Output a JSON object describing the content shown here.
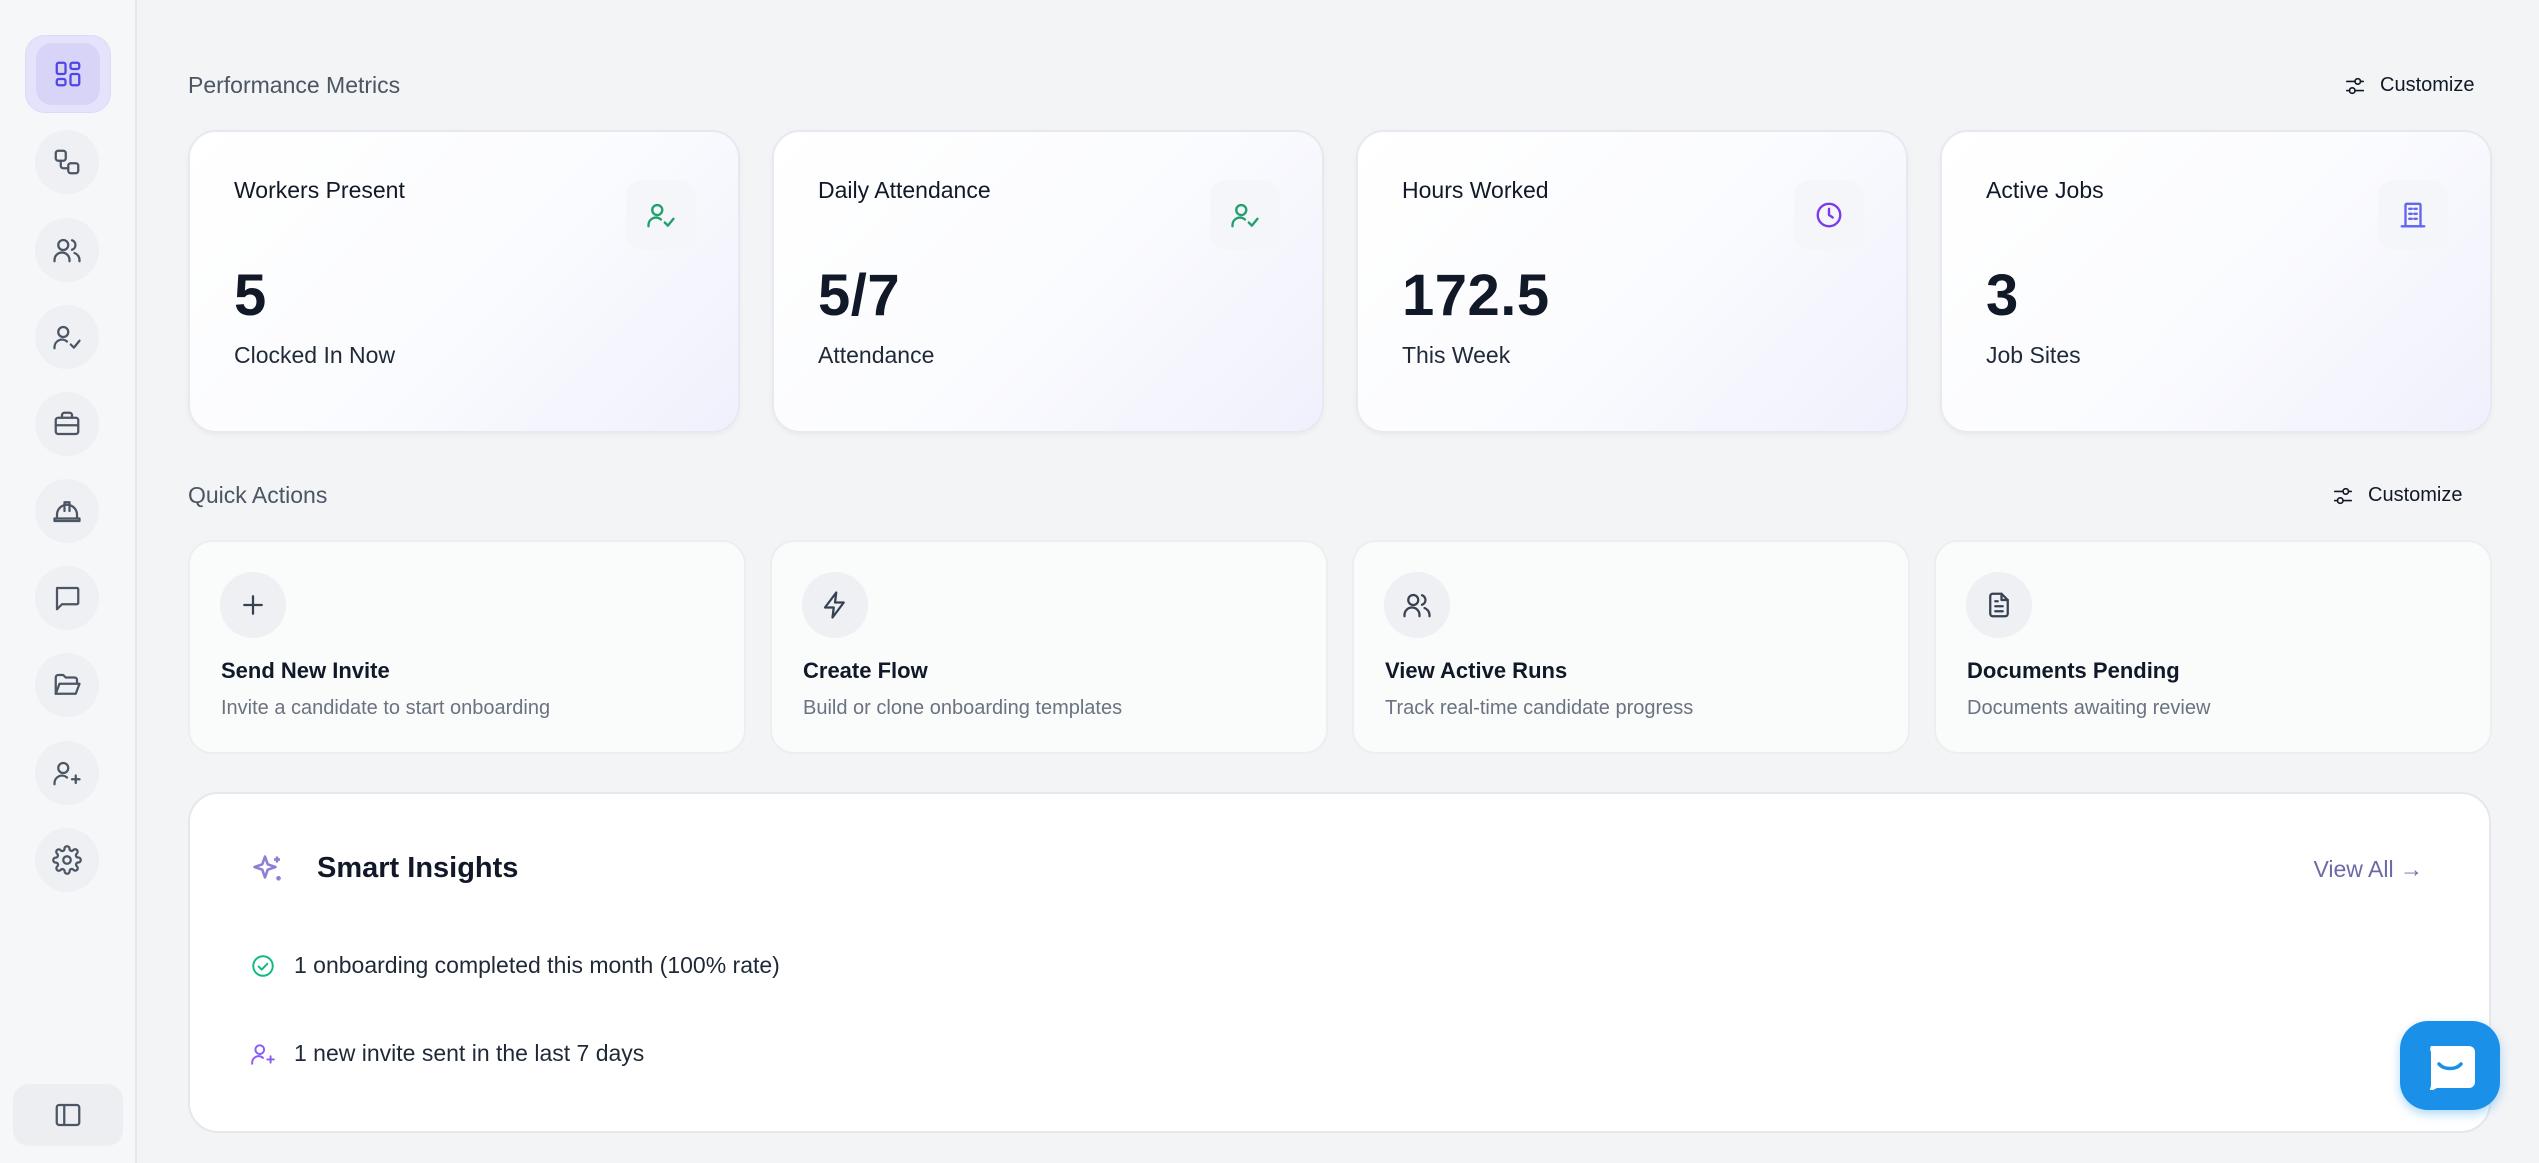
{
  "sidebar": {
    "items": [
      {
        "name": "dashboard",
        "icon": "dashboard-grid-icon"
      },
      {
        "name": "workflows",
        "icon": "workflow-icon"
      },
      {
        "name": "users",
        "icon": "users-icon"
      },
      {
        "name": "attendance",
        "icon": "user-check-icon"
      },
      {
        "name": "jobs",
        "icon": "briefcase-icon"
      },
      {
        "name": "safety",
        "icon": "hard-hat-icon"
      },
      {
        "name": "messages",
        "icon": "message-icon"
      },
      {
        "name": "documents",
        "icon": "folder-open-icon"
      },
      {
        "name": "invite",
        "icon": "user-plus-icon"
      },
      {
        "name": "settings",
        "icon": "gear-icon"
      }
    ],
    "collapse_icon": "sidebar-collapse-icon"
  },
  "performance": {
    "title": "Performance Metrics",
    "customize_label": "Customize",
    "cards": [
      {
        "title": "Workers Present",
        "value": "5",
        "subtitle": "Clocked In Now",
        "icon": "user-check-icon",
        "icon_color": "#22a06b"
      },
      {
        "title": "Daily Attendance",
        "value": "5/7",
        "subtitle": "Attendance",
        "icon": "user-check-icon",
        "icon_color": "#22a06b"
      },
      {
        "title": "Hours Worked",
        "value": "172.5",
        "subtitle": "This Week",
        "icon": "clock-icon",
        "icon_color": "#7c3aed"
      },
      {
        "title": "Active Jobs",
        "value": "3",
        "subtitle": "Job Sites",
        "icon": "building-icon",
        "icon_color": "#6366f1"
      }
    ]
  },
  "quick_actions": {
    "title": "Quick Actions",
    "customize_label": "Customize",
    "cards": [
      {
        "title": "Send New Invite",
        "description": "Invite a candidate to start onboarding",
        "icon": "plus-icon"
      },
      {
        "title": "Create Flow",
        "description": "Build or clone onboarding templates",
        "icon": "lightning-icon"
      },
      {
        "title": "View Active Runs",
        "description": "Track real-time candidate progress",
        "icon": "users-icon"
      },
      {
        "title": "Documents Pending",
        "description": "Documents awaiting review",
        "icon": "document-icon"
      }
    ]
  },
  "insights": {
    "title": "Smart Insights",
    "view_all_label": "View All →",
    "items": [
      {
        "text": "1 onboarding completed this month (100% rate)",
        "icon": "check-circle-icon",
        "icon_color": "#10b981"
      },
      {
        "text": "1 new invite sent in the last 7 days",
        "icon": "user-plus-icon",
        "icon_color": "#8b5cf6"
      }
    ]
  },
  "colors": {
    "accent": "#4f46e5",
    "chat_button": "#1b90e8",
    "background": "#f3f4f6"
  },
  "chat": {
    "icon": "chat-bubble-icon"
  }
}
